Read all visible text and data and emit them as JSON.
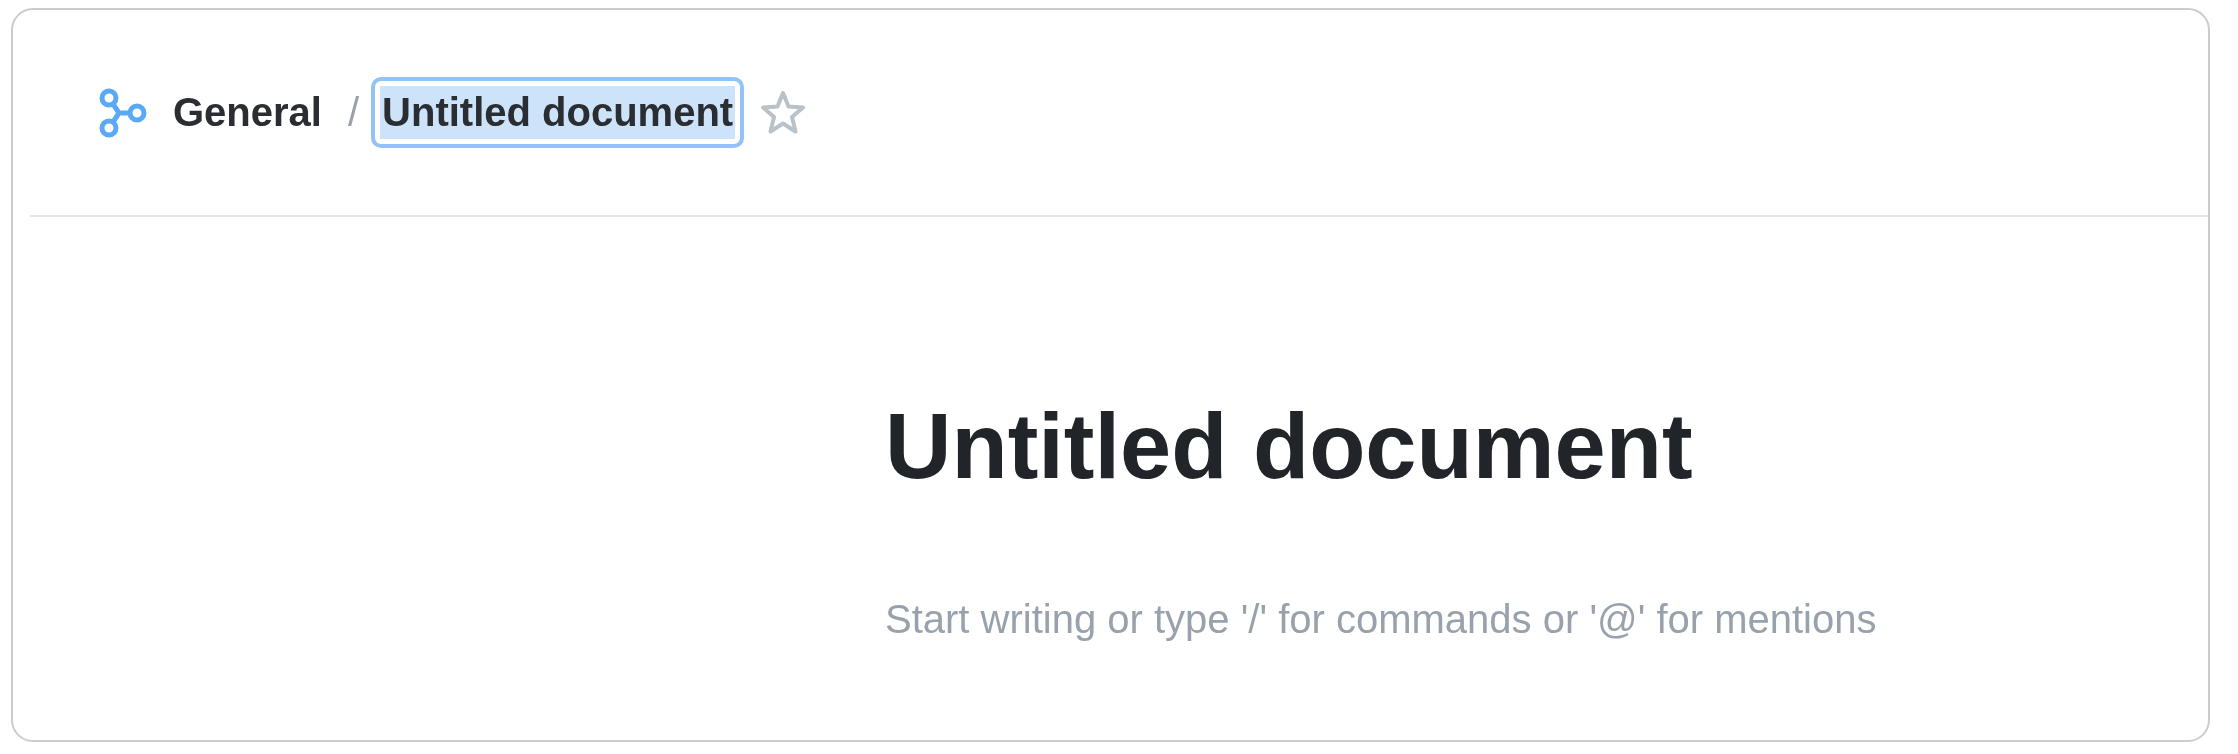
{
  "breadcrumb": {
    "space": "General",
    "separator": "/"
  },
  "title_field": {
    "value": "Untitled document",
    "focused": true,
    "text_selected": true
  },
  "favorite": {
    "starred": false
  },
  "document": {
    "heading": "Untitled document",
    "placeholder": "Start writing or type '/' for commands or '@' for mentions"
  }
}
